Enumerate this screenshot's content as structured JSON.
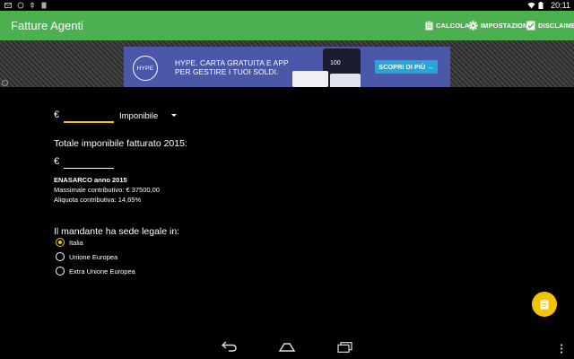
{
  "status_bar": {
    "time": "20:11",
    "left_icons": [
      "mail-icon",
      "sync-icon",
      "usb-icon",
      "download-icon"
    ],
    "right_icons": [
      "wifi-icon",
      "battery-icon"
    ]
  },
  "action_bar": {
    "title": "Fatture Agenti",
    "color": "#4caf50",
    "actions": [
      {
        "label": "CALCOLA",
        "icon": "clipboard-icon"
      },
      {
        "label": "IMPOSTAZIONI",
        "icon": "gear-icon"
      },
      {
        "label": "DISCLAIMER",
        "icon": "checklist-icon"
      }
    ]
  },
  "ad": {
    "logo": "HYPE",
    "text_line1": "HYPE. CARTA GRATUITA E APP",
    "text_line2": "PER GESTIRE I TUOI SOLDI.",
    "cta": "SCOPRI DI PIÙ →",
    "phone_value": "100",
    "colors": {
      "background": "#4b57a8",
      "cta": "#2aa3d9"
    }
  },
  "form": {
    "currency": "€",
    "amount_value": "",
    "amount_type": "Imponibile",
    "total_heading": "Totale imponibile fatturato 2015:",
    "total_currency": "€",
    "total_value": "",
    "enasarco_title": "ENASARCO anno 2015",
    "massimale": "Massimale contributivo: € 37500,00",
    "aliquota": "Aliquota contributiva: 14,65%",
    "sede_heading": "Il mandante ha sede legale in:",
    "sede_options": [
      {
        "label": "Italia",
        "selected": true
      },
      {
        "label": "Unione Europea",
        "selected": false
      },
      {
        "label": "Extra Unione Europea",
        "selected": false
      }
    ],
    "accent_color": "#f5c400"
  },
  "fab": {
    "icon": "clipboard-icon"
  },
  "nav_bar": {
    "buttons": [
      "back-icon",
      "home-icon",
      "recents-icon",
      "overflow-menu-icon"
    ]
  }
}
